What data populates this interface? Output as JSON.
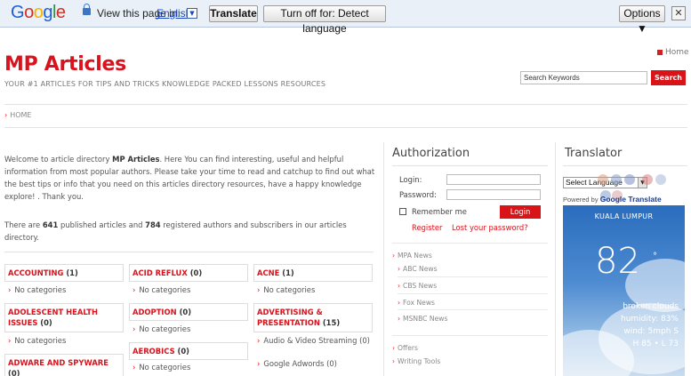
{
  "translate_bar": {
    "logo": "Google",
    "view_text": "View this page in:",
    "language": "English",
    "translate_label": "Translate",
    "turnoff_label": "Turn off for: Detect language",
    "options_label": "Options ▼",
    "close_symbol": "✕"
  },
  "header": {
    "home_label": "Home",
    "title": "MP Articles",
    "tagline": "YOUR #1 ARTICLES FOR TIPS AND TRICKS KNOWLEDGE PACKED LESSONS RESOURCES",
    "search_placeholder": "Search Keywords",
    "search_button": "Search"
  },
  "nav": {
    "home": "HOME"
  },
  "main": {
    "welcome_prefix": "Welcome to article directory ",
    "welcome_site": "MP Articles",
    "welcome_body": ". Here You can find interesting, useful and helpful information from most popular authors. Please take your time to read and catchup to find out what the best tips or info that you need on this articles directory resources, have a happy knowledge explore! . Thank you.",
    "stats_prefix": "There are ",
    "articles_count": "641",
    "stats_mid": " published articles and ",
    "authors_count": "784",
    "stats_suffix": " registered authors and subscribers in our articles directory.",
    "categories": [
      {
        "name": "ACCOUNTING",
        "count": "(1)"
      },
      {
        "name": "ACID REFLUX",
        "count": "(0)"
      },
      {
        "name": "ACNE",
        "count": "(1)"
      },
      {
        "name": "ADOLESCENT HEALTH ISSUES",
        "count": "(0)"
      },
      {
        "name": "ADOPTION",
        "count": "(0)"
      },
      {
        "name": "ADVERTISING & PRESENTATION",
        "count": "(15)"
      },
      {
        "name": "AEROBICS",
        "count": "(0)"
      },
      {
        "name": "ADWARE AND SPYWARE",
        "count": "(0)"
      }
    ],
    "no_categories": "No categories",
    "subcats": [
      {
        "name": "Audio & Video Streaming",
        "count": "(0)"
      },
      {
        "name": "Google Adwords",
        "count": "(0)"
      }
    ]
  },
  "auth": {
    "title": "Authorization",
    "login_label": "Login:",
    "password_label": "Password:",
    "remember_label": "Remember me",
    "login_button": "Login",
    "register_link": "Register",
    "lost_password_link": "Lost your password?"
  },
  "side_links": {
    "mpa_news": "MPA News",
    "abc_news": "ABC News",
    "cbs_news": "CBS News",
    "fox_news": "Fox News",
    "msnbc_news": "MSNBC News",
    "offers": "Offers",
    "writing_tools": "Writing Tools"
  },
  "translator": {
    "title": "Translator",
    "select_label": "Select Language",
    "powered_by": "Powered by",
    "google_translate": "Google Translate"
  },
  "weather": {
    "city": "KUALA LUMPUR",
    "temp": "82",
    "deg": "°",
    "condition": "broken clouds",
    "humidity": "humidity: 83%",
    "wind": "wind: 5mph S",
    "hilo": "H 85 • L 73"
  },
  "colors": {
    "accent": "#d91419",
    "bar_bg": "#eaf0f8"
  }
}
